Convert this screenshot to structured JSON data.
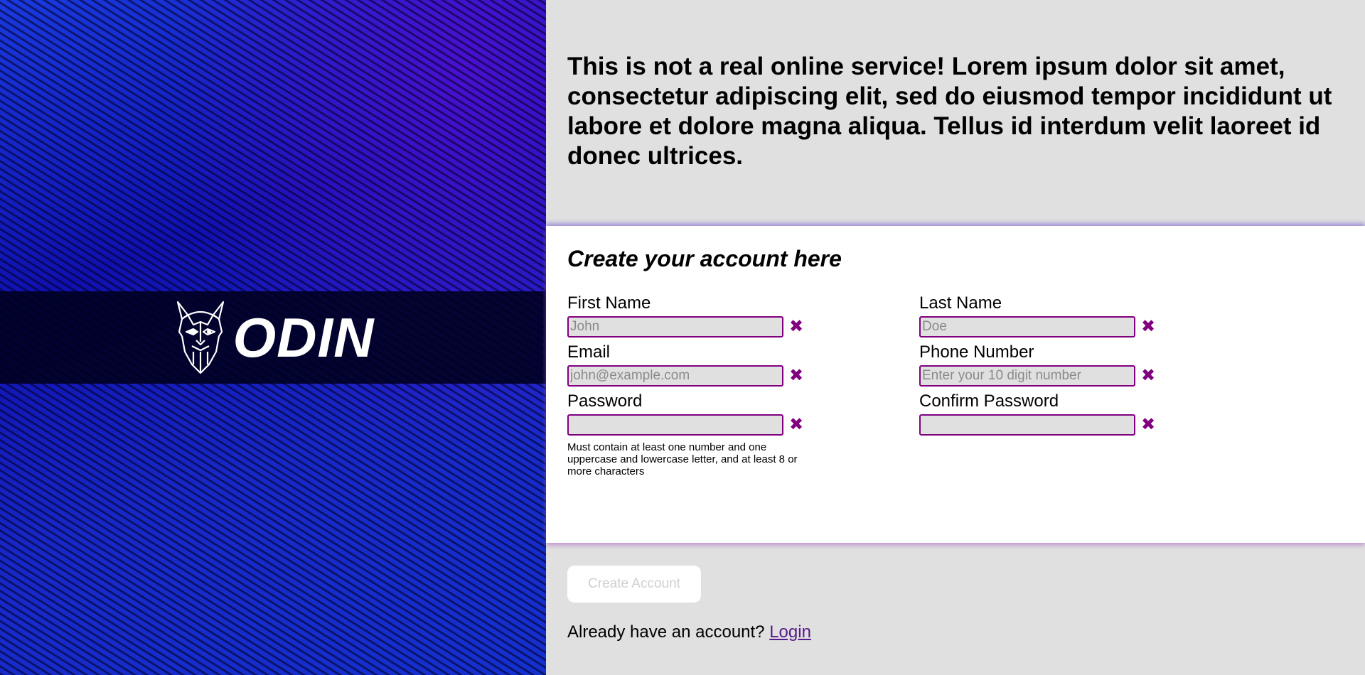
{
  "brand": {
    "name": "ODIN",
    "logo_icon": "viking-helmet-icon"
  },
  "intro": {
    "text": "This is not a real online service! Lorem ipsum dolor sit amet, consectetur adipiscing elit, sed do eiusmod tempor incididunt ut labore et dolore magna aliqua. Tellus id interdum velit laoreet id donec ultrices."
  },
  "form": {
    "heading": "Create your account here",
    "fields": {
      "first_name": {
        "label": "First Name",
        "placeholder": "John",
        "value": ""
      },
      "last_name": {
        "label": "Last Name",
        "placeholder": "Doe",
        "value": ""
      },
      "email": {
        "label": "Email",
        "placeholder": "john@example.com",
        "value": ""
      },
      "phone": {
        "label": "Phone Number",
        "placeholder": "Enter your 10 digit number",
        "value": ""
      },
      "password": {
        "label": "Password",
        "placeholder": "",
        "value": ""
      },
      "confirm_password": {
        "label": "Confirm Password",
        "placeholder": "",
        "value": ""
      }
    },
    "invalid_icon": "✖",
    "password_hint": "Must contain at least one number and one uppercase and lowercase letter, and at least 8 or more characters"
  },
  "footer": {
    "submit_label": "Create Account",
    "login_prompt": "Already have an account?",
    "login_link": "Login"
  },
  "colors": {
    "accent": "#800080",
    "link": "#551a8b",
    "panel_bg": "#e0e0e0"
  }
}
